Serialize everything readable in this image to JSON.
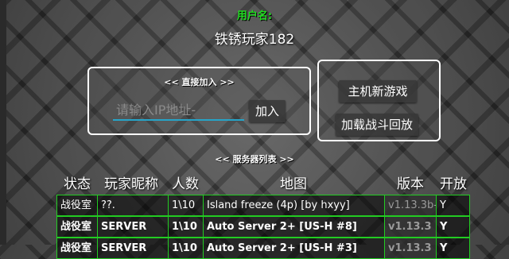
{
  "header": {
    "username_label": "用户名:",
    "username": "铁锈玩家182"
  },
  "direct_join": {
    "title": "<< 直接加入 >>",
    "ip_placeholder": "请输入IP地址-",
    "ip_value": "",
    "join_label": "加入"
  },
  "host": {
    "new_game_label": "主机新游戏",
    "load_replay_label": "加载战斗回放"
  },
  "server_list": {
    "title": "<< 服务器列表 >>",
    "columns": [
      "状态",
      "玩家昵称",
      "人数",
      "地图",
      "版本",
      "开放"
    ],
    "rows": [
      {
        "state": "战役室",
        "name": "??.",
        "count": "1\\10",
        "map": "Island freeze (4p) [by hxyy]",
        "version": "v1.13.3b-",
        "open": "Y"
      },
      {
        "state": "战役室",
        "name": "SERVER",
        "count": "1\\10",
        "map": "Auto Server 2+ [US-H #8]",
        "version": "v1.13.3",
        "open": "Y"
      },
      {
        "state": "战役室",
        "name": "SERVER",
        "count": "1\\10",
        "map": "Auto Server 2+ [US-H #3]",
        "version": "v1.13.3",
        "open": "Y"
      }
    ]
  },
  "colors": {
    "accent_green": "#22dd22",
    "input_underline": "#26a4c8",
    "panel_border": "#ffffff"
  }
}
